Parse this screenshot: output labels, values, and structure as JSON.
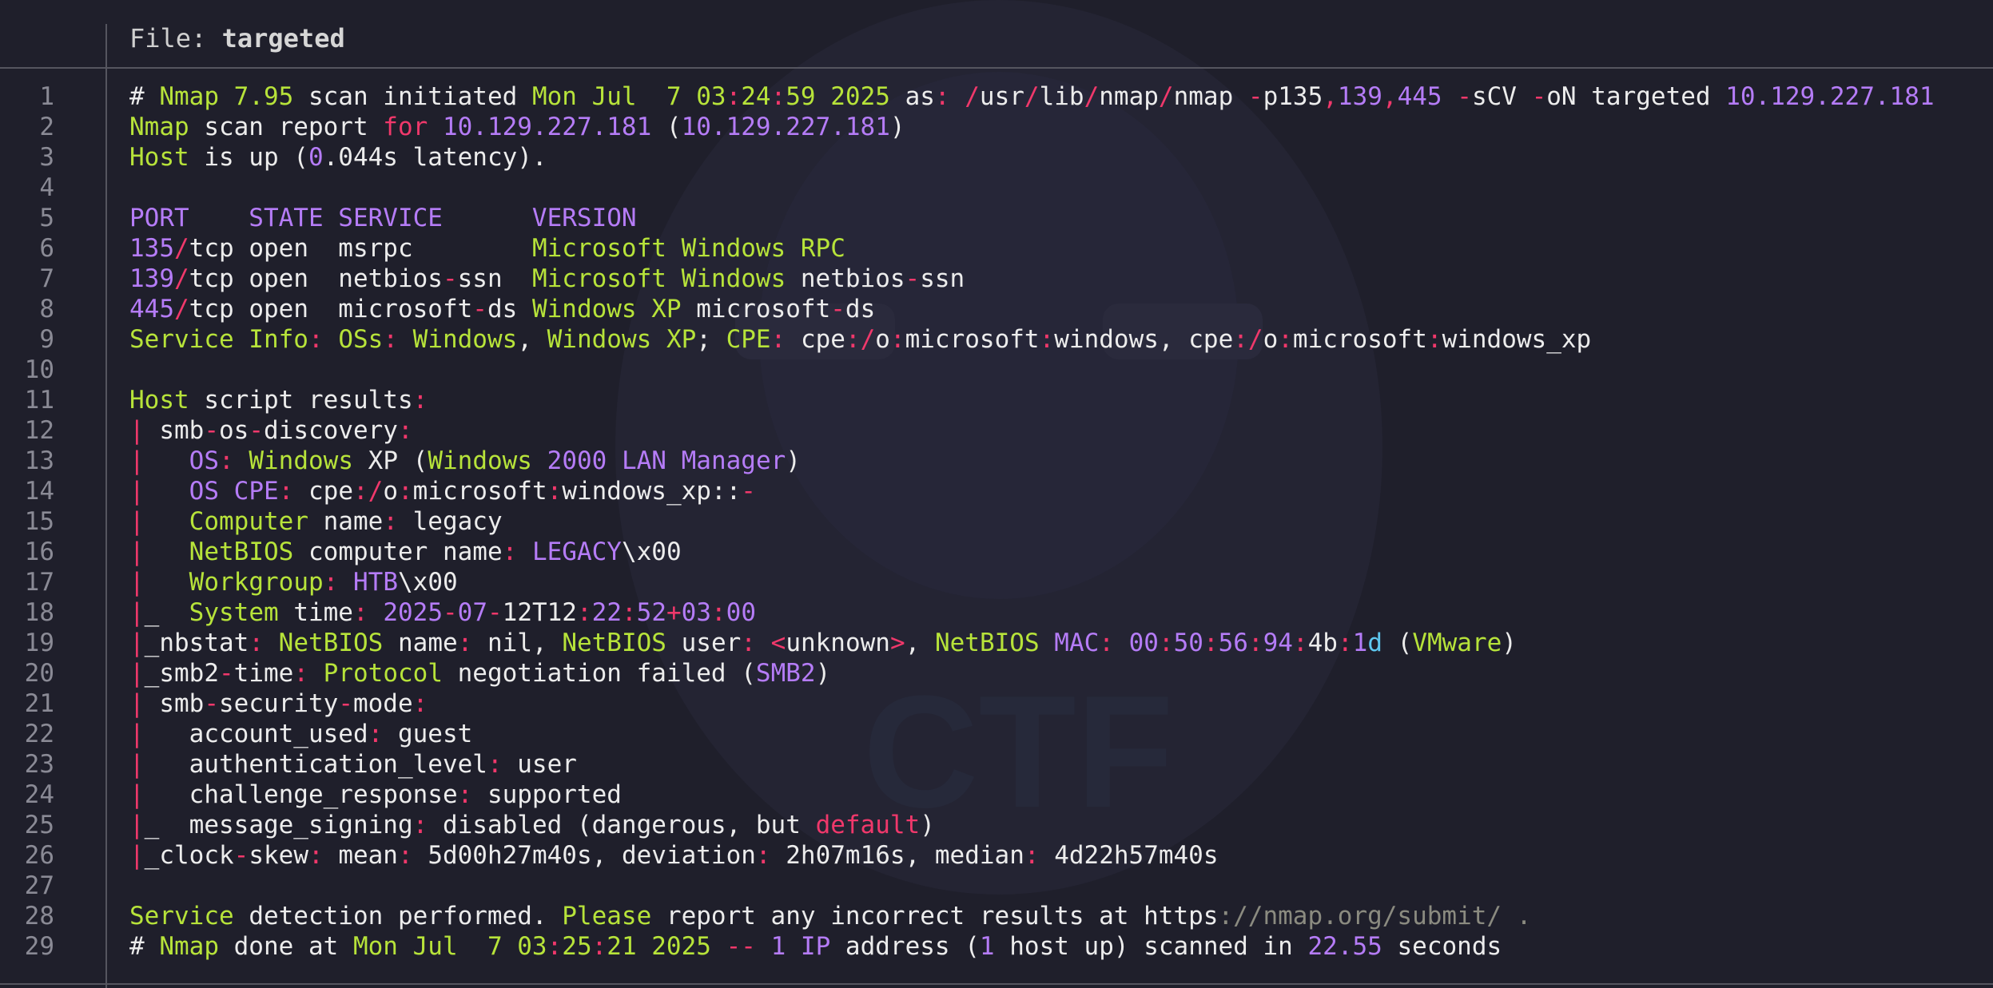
{
  "file": {
    "prefix": "File: ",
    "name": "targeted"
  },
  "lines": [
    {
      "n": "1",
      "segs": [
        [
          "w",
          "# "
        ],
        [
          "g",
          "Nmap"
        ],
        [
          "w",
          " "
        ],
        [
          "g",
          "7.95"
        ],
        [
          "w",
          " scan initiated "
        ],
        [
          "g",
          "Mon Jul  7 03"
        ],
        [
          "r",
          ":"
        ],
        [
          "g",
          "24"
        ],
        [
          "r",
          ":"
        ],
        [
          "g",
          "59 2025"
        ],
        [
          "w",
          " as"
        ],
        [
          "r",
          ":"
        ],
        [
          "w",
          " "
        ],
        [
          "r",
          "/"
        ],
        [
          "w",
          "usr"
        ],
        [
          "r",
          "/"
        ],
        [
          "w",
          "lib"
        ],
        [
          "r",
          "/"
        ],
        [
          "w",
          "nmap"
        ],
        [
          "r",
          "/"
        ],
        [
          "w",
          "nmap "
        ],
        [
          "r",
          "-"
        ],
        [
          "w",
          "p135"
        ],
        [
          "r",
          ","
        ],
        [
          "p",
          "139"
        ],
        [
          "r",
          ","
        ],
        [
          "p",
          "445"
        ],
        [
          "w",
          " "
        ],
        [
          "r",
          "-"
        ],
        [
          "w",
          "sCV "
        ],
        [
          "r",
          "-"
        ],
        [
          "w",
          "oN targeted "
        ],
        [
          "p",
          "10.129.227.181"
        ]
      ]
    },
    {
      "n": "2",
      "segs": [
        [
          "g",
          "Nmap"
        ],
        [
          "w",
          " scan report "
        ],
        [
          "r",
          "for"
        ],
        [
          "w",
          " "
        ],
        [
          "p",
          "10.129.227.181"
        ],
        [
          "w",
          " ("
        ],
        [
          "p",
          "10.129.227.181"
        ],
        [
          "w",
          ")"
        ]
      ]
    },
    {
      "n": "3",
      "segs": [
        [
          "g",
          "Host"
        ],
        [
          "w",
          " is up ("
        ],
        [
          "p",
          "0"
        ],
        [
          "w",
          ".044s latency)."
        ]
      ]
    },
    {
      "n": "4",
      "segs": []
    },
    {
      "n": "5",
      "segs": [
        [
          "p",
          "PORT    STATE SERVICE      VERSION"
        ]
      ]
    },
    {
      "n": "6",
      "segs": [
        [
          "p",
          "135"
        ],
        [
          "r",
          "/"
        ],
        [
          "w",
          "tcp open  msrpc        "
        ],
        [
          "g",
          "Microsoft Windows RPC"
        ]
      ]
    },
    {
      "n": "7",
      "segs": [
        [
          "p",
          "139"
        ],
        [
          "r",
          "/"
        ],
        [
          "w",
          "tcp open  netbios"
        ],
        [
          "r",
          "-"
        ],
        [
          "w",
          "ssn  "
        ],
        [
          "g",
          "Microsoft Windows"
        ],
        [
          "w",
          " netbios"
        ],
        [
          "r",
          "-"
        ],
        [
          "w",
          "ssn"
        ]
      ]
    },
    {
      "n": "8",
      "segs": [
        [
          "p",
          "445"
        ],
        [
          "r",
          "/"
        ],
        [
          "w",
          "tcp open  microsoft"
        ],
        [
          "r",
          "-"
        ],
        [
          "w",
          "ds "
        ],
        [
          "g",
          "Windows XP"
        ],
        [
          "w",
          " microsoft"
        ],
        [
          "r",
          "-"
        ],
        [
          "w",
          "ds"
        ]
      ]
    },
    {
      "n": "9",
      "segs": [
        [
          "g",
          "Service Info"
        ],
        [
          "r",
          ":"
        ],
        [
          "w",
          " "
        ],
        [
          "g",
          "OSs"
        ],
        [
          "r",
          ":"
        ],
        [
          "w",
          " "
        ],
        [
          "g",
          "Windows"
        ],
        [
          "w",
          ", "
        ],
        [
          "g",
          "Windows XP"
        ],
        [
          "w",
          "; "
        ],
        [
          "g",
          "CPE"
        ],
        [
          "r",
          ":"
        ],
        [
          "w",
          " cpe"
        ],
        [
          "r",
          ":/"
        ],
        [
          "w",
          "o"
        ],
        [
          "r",
          ":"
        ],
        [
          "w",
          "microsoft"
        ],
        [
          "r",
          ":"
        ],
        [
          "w",
          "windows, cpe"
        ],
        [
          "r",
          ":/"
        ],
        [
          "w",
          "o"
        ],
        [
          "r",
          ":"
        ],
        [
          "w",
          "microsoft"
        ],
        [
          "r",
          ":"
        ],
        [
          "w",
          "windows_xp"
        ]
      ]
    },
    {
      "n": "10",
      "segs": []
    },
    {
      "n": "11",
      "segs": [
        [
          "g",
          "Host"
        ],
        [
          "w",
          " script results"
        ],
        [
          "r",
          ":"
        ]
      ]
    },
    {
      "n": "12",
      "segs": [
        [
          "r",
          "|"
        ],
        [
          "w",
          " smb"
        ],
        [
          "r",
          "-"
        ],
        [
          "w",
          "os"
        ],
        [
          "r",
          "-"
        ],
        [
          "w",
          "discovery"
        ],
        [
          "r",
          ":"
        ]
      ]
    },
    {
      "n": "13",
      "segs": [
        [
          "r",
          "|"
        ],
        [
          "w",
          "   "
        ],
        [
          "p",
          "OS"
        ],
        [
          "r",
          ":"
        ],
        [
          "w",
          " "
        ],
        [
          "g",
          "Windows"
        ],
        [
          "w",
          " XP ("
        ],
        [
          "g",
          "Windows"
        ],
        [
          "w",
          " "
        ],
        [
          "p",
          "2000 LAN Manager"
        ],
        [
          "w",
          ")"
        ]
      ]
    },
    {
      "n": "14",
      "segs": [
        [
          "r",
          "|"
        ],
        [
          "w",
          "   "
        ],
        [
          "p",
          "OS CPE"
        ],
        [
          "r",
          ":"
        ],
        [
          "w",
          " cpe"
        ],
        [
          "r",
          ":/"
        ],
        [
          "w",
          "o"
        ],
        [
          "r",
          ":"
        ],
        [
          "w",
          "microsoft"
        ],
        [
          "r",
          ":"
        ],
        [
          "w",
          "windows_xp::"
        ],
        [
          "r",
          "-"
        ]
      ]
    },
    {
      "n": "15",
      "segs": [
        [
          "r",
          "|"
        ],
        [
          "w",
          "   "
        ],
        [
          "g",
          "Computer"
        ],
        [
          "w",
          " name"
        ],
        [
          "r",
          ":"
        ],
        [
          "w",
          " legacy"
        ]
      ]
    },
    {
      "n": "16",
      "segs": [
        [
          "r",
          "|"
        ],
        [
          "w",
          "   "
        ],
        [
          "g",
          "NetBIOS"
        ],
        [
          "w",
          " computer name"
        ],
        [
          "r",
          ":"
        ],
        [
          "w",
          " "
        ],
        [
          "p",
          "LEGACY"
        ],
        [
          "w",
          "\\x00"
        ]
      ]
    },
    {
      "n": "17",
      "segs": [
        [
          "r",
          "|"
        ],
        [
          "w",
          "   "
        ],
        [
          "g",
          "Workgroup"
        ],
        [
          "r",
          ":"
        ],
        [
          "w",
          " "
        ],
        [
          "p",
          "HTB"
        ],
        [
          "w",
          "\\x00"
        ]
      ]
    },
    {
      "n": "18",
      "segs": [
        [
          "r",
          "|"
        ],
        [
          "w",
          "_  "
        ],
        [
          "g",
          "System"
        ],
        [
          "w",
          " time"
        ],
        [
          "r",
          ":"
        ],
        [
          "w",
          " "
        ],
        [
          "p",
          "2025"
        ],
        [
          "r",
          "-"
        ],
        [
          "p",
          "07"
        ],
        [
          "r",
          "-"
        ],
        [
          "w",
          "12T12"
        ],
        [
          "r",
          ":"
        ],
        [
          "p",
          "22"
        ],
        [
          "r",
          ":"
        ],
        [
          "p",
          "52"
        ],
        [
          "r",
          "+"
        ],
        [
          "p",
          "03"
        ],
        [
          "r",
          ":"
        ],
        [
          "p",
          "00"
        ]
      ]
    },
    {
      "n": "19",
      "segs": [
        [
          "r",
          "|"
        ],
        [
          "w",
          "_nbstat"
        ],
        [
          "r",
          ":"
        ],
        [
          "w",
          " "
        ],
        [
          "g",
          "NetBIOS"
        ],
        [
          "w",
          " name"
        ],
        [
          "r",
          ":"
        ],
        [
          "w",
          " nil, "
        ],
        [
          "g",
          "NetBIOS"
        ],
        [
          "w",
          " user"
        ],
        [
          "r",
          ":"
        ],
        [
          "w",
          " "
        ],
        [
          "r",
          "<"
        ],
        [
          "w",
          "unknown"
        ],
        [
          "r",
          ">"
        ],
        [
          "w",
          ", "
        ],
        [
          "g",
          "NetBIOS"
        ],
        [
          "w",
          " "
        ],
        [
          "p",
          "MAC"
        ],
        [
          "r",
          ":"
        ],
        [
          "w",
          " "
        ],
        [
          "p",
          "00"
        ],
        [
          "r",
          ":"
        ],
        [
          "p",
          "50"
        ],
        [
          "r",
          ":"
        ],
        [
          "p",
          "56"
        ],
        [
          "r",
          ":"
        ],
        [
          "p",
          "94"
        ],
        [
          "r",
          ":"
        ],
        [
          "w",
          "4b"
        ],
        [
          "r",
          ":"
        ],
        [
          "p",
          "1"
        ],
        [
          "c",
          "d"
        ],
        [
          "w",
          " ("
        ],
        [
          "g",
          "VMware"
        ],
        [
          "w",
          ")"
        ]
      ]
    },
    {
      "n": "20",
      "segs": [
        [
          "r",
          "|"
        ],
        [
          "w",
          "_smb2"
        ],
        [
          "r",
          "-"
        ],
        [
          "w",
          "time"
        ],
        [
          "r",
          ":"
        ],
        [
          "w",
          " "
        ],
        [
          "g",
          "Protocol"
        ],
        [
          "w",
          " negotiation failed ("
        ],
        [
          "p",
          "SMB2"
        ],
        [
          "w",
          ")"
        ]
      ]
    },
    {
      "n": "21",
      "segs": [
        [
          "r",
          "|"
        ],
        [
          "w",
          " smb"
        ],
        [
          "r",
          "-"
        ],
        [
          "w",
          "security"
        ],
        [
          "r",
          "-"
        ],
        [
          "w",
          "mode"
        ],
        [
          "r",
          ":"
        ]
      ]
    },
    {
      "n": "22",
      "segs": [
        [
          "r",
          "|"
        ],
        [
          "w",
          "   account_used"
        ],
        [
          "r",
          ":"
        ],
        [
          "w",
          " guest"
        ]
      ]
    },
    {
      "n": "23",
      "segs": [
        [
          "r",
          "|"
        ],
        [
          "w",
          "   authentication_level"
        ],
        [
          "r",
          ":"
        ],
        [
          "w",
          " user"
        ]
      ]
    },
    {
      "n": "24",
      "segs": [
        [
          "r",
          "|"
        ],
        [
          "w",
          "   challenge_response"
        ],
        [
          "r",
          ":"
        ],
        [
          "w",
          " supported"
        ]
      ]
    },
    {
      "n": "25",
      "segs": [
        [
          "r",
          "|"
        ],
        [
          "w",
          "_  message_signing"
        ],
        [
          "r",
          ":"
        ],
        [
          "w",
          " disabled (dangerous, but "
        ],
        [
          "r",
          "default"
        ],
        [
          "w",
          ")"
        ]
      ]
    },
    {
      "n": "26",
      "segs": [
        [
          "r",
          "|"
        ],
        [
          "w",
          "_clock"
        ],
        [
          "r",
          "-"
        ],
        [
          "w",
          "skew"
        ],
        [
          "r",
          ":"
        ],
        [
          "w",
          " mean"
        ],
        [
          "r",
          ":"
        ],
        [
          "w",
          " 5d00h27m40s, deviation"
        ],
        [
          "r",
          ":"
        ],
        [
          "w",
          " 2h07m16s, median"
        ],
        [
          "r",
          ":"
        ],
        [
          "w",
          " 4d22h57m40s"
        ]
      ]
    },
    {
      "n": "27",
      "segs": []
    },
    {
      "n": "28",
      "segs": [
        [
          "g",
          "Service"
        ],
        [
          "w",
          " detection performed. "
        ],
        [
          "g",
          "Please"
        ],
        [
          "w",
          " report any incorrect results at https"
        ],
        [
          "gr",
          "://nmap.org/submit/ ."
        ]
      ]
    },
    {
      "n": "29",
      "segs": [
        [
          "w",
          "# "
        ],
        [
          "g",
          "Nmap"
        ],
        [
          "w",
          " done at "
        ],
        [
          "g",
          "Mon Jul  7 03"
        ],
        [
          "r",
          ":"
        ],
        [
          "g",
          "25"
        ],
        [
          "r",
          ":"
        ],
        [
          "g",
          "21 2025"
        ],
        [
          "w",
          " "
        ],
        [
          "r",
          "--"
        ],
        [
          "w",
          " "
        ],
        [
          "p",
          "1 IP"
        ],
        [
          "w",
          " address ("
        ],
        [
          "p",
          "1"
        ],
        [
          "w",
          " host up) scanned in "
        ],
        [
          "p",
          "22.55"
        ],
        [
          "w",
          " seconds"
        ]
      ]
    }
  ]
}
